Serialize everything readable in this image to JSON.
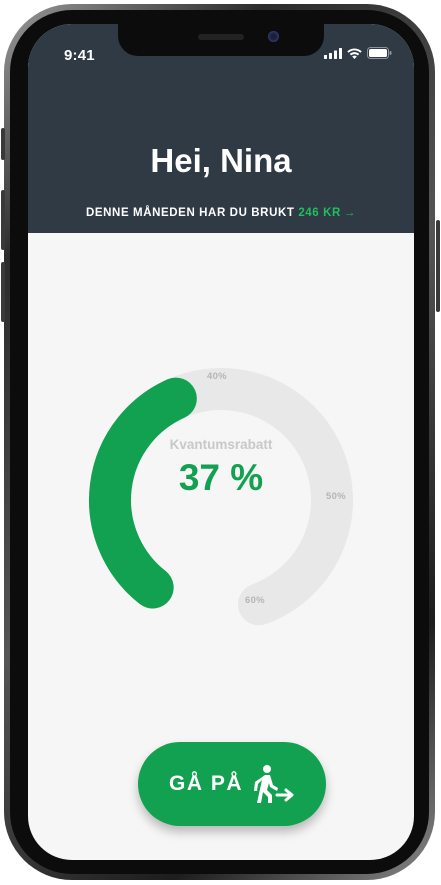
{
  "status_bar": {
    "time": "9:41"
  },
  "header": {
    "greeting": "Hei, Nina",
    "spend_text": "DENNE MÅNEDEN HAR DU BRUKT",
    "spend_amount": "246 KR",
    "spend_arrow": "→",
    "background_color": "#2f3a44"
  },
  "gauge": {
    "title": "Kvantumsrabatt",
    "value_text": "37 %",
    "progress_percent": 37,
    "ticks": [
      "40%",
      "50%",
      "60%"
    ],
    "fill_color": "#12a150",
    "track_color": "#e8e8e8"
  },
  "cta": {
    "label": "GÅ PÅ",
    "icon": "walking-person-arrow-icon",
    "color": "#12a150"
  },
  "colors": {
    "accent": "#1fbf5f",
    "screen_background": "#f6f6f6"
  }
}
